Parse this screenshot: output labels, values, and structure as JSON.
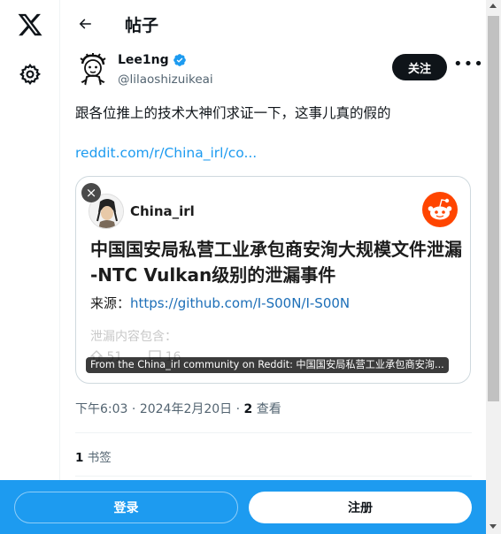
{
  "header": {
    "title": "帖子"
  },
  "post": {
    "display_name": "Lee1ng",
    "handle": "@lilaoshizuikeai",
    "follow_label": "关注",
    "more_label": "•••",
    "text": "跟各位推上的技术大神们求证一下，这事儿真的假的",
    "link_text": "reddit.com/r/China_irl/co...",
    "time": "下午6:03",
    "date": "2024年2月20日",
    "views_count": "2",
    "views_label": "查看",
    "bookmarks_count": "1",
    "bookmarks_label": "书签"
  },
  "card": {
    "close_label": "×",
    "community": "China_irl",
    "title": "中国国安局私营工业承包商安洵大规模文件泄漏 -NTC Vulkan级别的泄漏事件",
    "source_prefix": "来源：",
    "source_url": "https://github.com/I-S00N/I-S00N",
    "faded_text": "泄漏内容包含：",
    "upvotes": "51",
    "comments": "16",
    "caption": "From the China_irl community on Reddit: 中国国安局私营工业承包商安洵..."
  },
  "bottom_bar": {
    "login_label": "登录",
    "signup_label": "注册"
  },
  "colors": {
    "accent": "#1d9bf0",
    "reddit": "#ff4500",
    "verified": "#1d9bf0"
  },
  "icons": [
    "x-logo-icon",
    "gear-icon",
    "back-arrow-icon",
    "verified-badge-icon",
    "more-icon",
    "close-icon",
    "reddit-logo-icon",
    "upvote-icon",
    "comment-icon"
  ]
}
